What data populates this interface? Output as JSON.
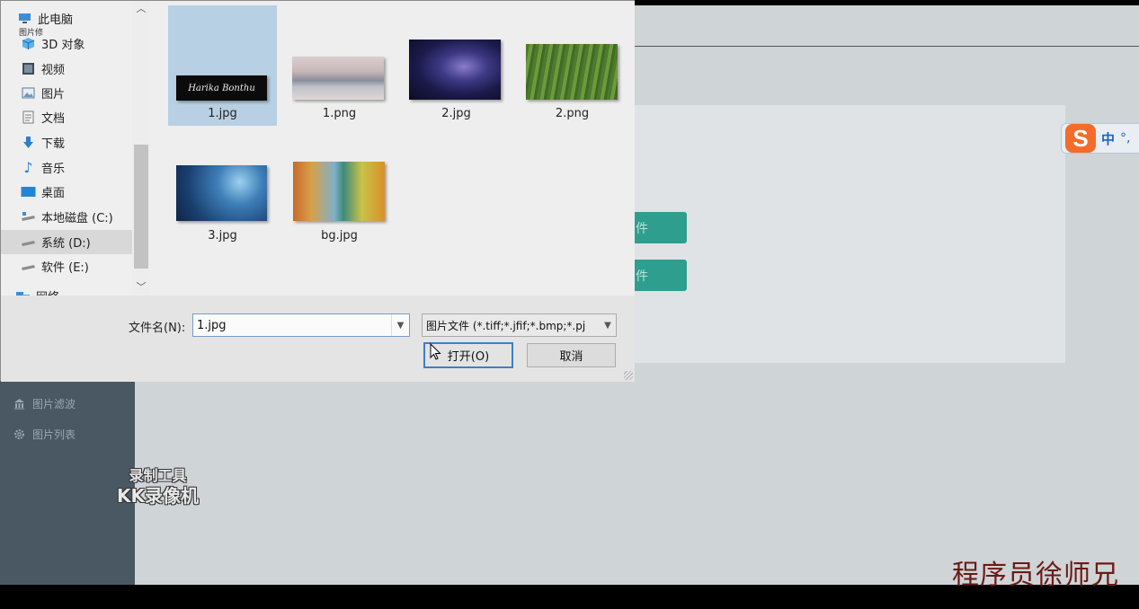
{
  "app": {
    "sidebar": [
      {
        "label": "图片滤波",
        "icon": "bank-icon"
      },
      {
        "label": "图片列表",
        "icon": "gear-icon"
      }
    ],
    "button_fragment_1": "件",
    "button_fragment_2": "件",
    "ime": {
      "logo": "S",
      "lang": "中",
      "punct": "°,"
    }
  },
  "dialog": {
    "nav": {
      "items": [
        {
          "label": "此电脑",
          "icon": "computer-icon"
        },
        {
          "label": "3D 对象",
          "icon": "cube-icon"
        },
        {
          "label": "视频",
          "icon": "video-icon"
        },
        {
          "label": "图片",
          "icon": "pictures-icon"
        },
        {
          "label": "文档",
          "icon": "document-icon"
        },
        {
          "label": "下载",
          "icon": "download-icon"
        },
        {
          "label": "音乐",
          "icon": "music-icon"
        },
        {
          "label": "桌面",
          "icon": "desktop-icon"
        },
        {
          "label": "本地磁盘 (C:)",
          "icon": "drive-icon"
        },
        {
          "label": "系统 (D:)",
          "icon": "drive-icon"
        },
        {
          "label": "软件 (E:)",
          "icon": "drive-icon"
        },
        {
          "label": "网络",
          "icon": "network-icon"
        }
      ],
      "selected": "系统 (D:)",
      "tooltip_fragment": "图片修"
    },
    "files": [
      {
        "name": "1.jpg",
        "selected": true,
        "thumb_text": "Harika Bonthu"
      },
      {
        "name": "1.png",
        "selected": false
      },
      {
        "name": "2.jpg",
        "selected": false
      },
      {
        "name": "2.png",
        "selected": false
      },
      {
        "name": "3.jpg",
        "selected": false
      },
      {
        "name": "bg.jpg",
        "selected": false
      }
    ],
    "filename_label": "文件名(N):",
    "filename_value": "1.jpg",
    "filetype_value": "图片文件 (*.tiff;*.jfif;*.bmp;*.pj",
    "open_label": "打开(O)",
    "cancel_label": "取消"
  },
  "watermarks": {
    "recorder_line1": "录制工具",
    "recorder_line2": "KK录像机",
    "author": "程序员徐师兄"
  }
}
